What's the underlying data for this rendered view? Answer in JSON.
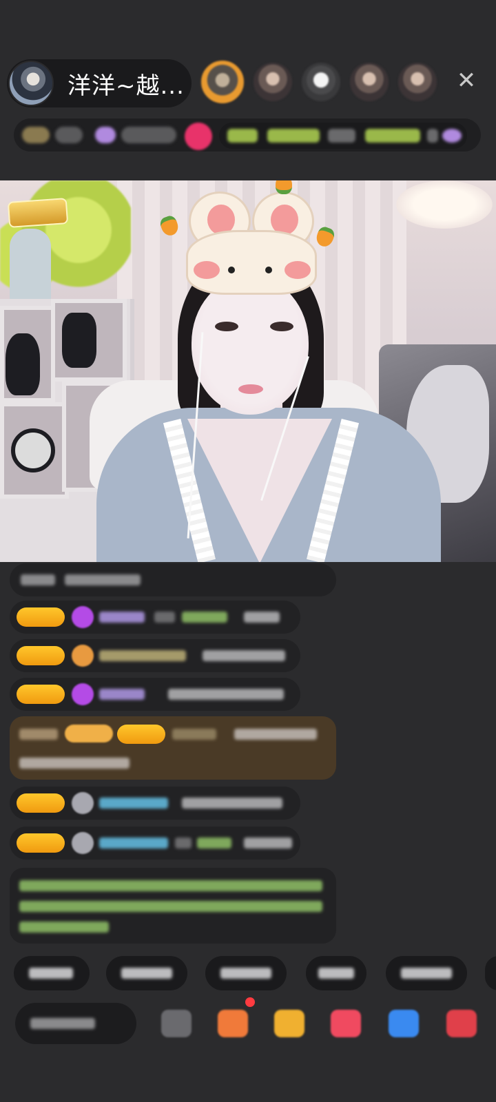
{
  "header": {
    "host_name": "洋洋~越...",
    "close_icon": "close-icon",
    "close_symbol": "✕"
  },
  "colors": {
    "background": "#2b2b2d",
    "level_badge": "#f09a10",
    "hot_badge": "#e8336a",
    "notification_dot": "#ff3b40"
  }
}
